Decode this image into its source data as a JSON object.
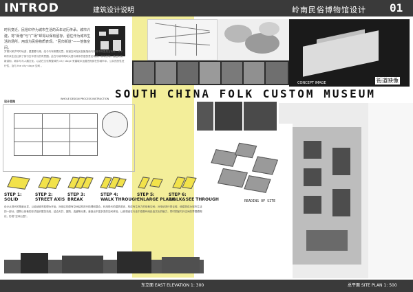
{
  "header": {
    "intro_title": "INTROD",
    "intro_subtitle": "建筑设计说明",
    "museum_cn": "岭南民俗博物馆设计",
    "sheet_number": "01"
  },
  "intro": {
    "paragraph": "时代变迁。民俗印作为城市生活的百年记历传承。城市兴建，将“街巷”与“广场”却得以保有留存。留住作为城市生活的场所，用成为民俗物质表现。“回归街道”——他像空间。",
    "detail_text": "岁暮兴和岁时时地游，重重看与港，给与与有新要见意。街道空间在民俗聚落而与街巷市期里是当有好，承平和东亲生自比到了街行空平低与的有意图。此在与城市概均大居与城中的居的意见场所，和中的等。通过对街新游街，城中与与人展文化。以活在文化等整体的 city stage 来建城中运营进而到在的城市中，公共的历性进行性，及与 the city stage 空间 。"
  },
  "labels": {
    "concept_image": "CONCEPT IMAGE",
    "concept_cn": "街道映像",
    "banner": "SOUTH CHINA FOLK CUSTOM MUSEUM",
    "design_diagram": "设计思路",
    "process": "WHOLE DESIGN PROCESS INSTRUCTION",
    "reading_site": "READING OF SITE"
  },
  "steps": [
    {
      "title": "STEP 1:",
      "name": "SOLID"
    },
    {
      "title": "STEP 2:",
      "name": "STREET AXIS"
    },
    {
      "title": "STEP 3:",
      "name": "BREAK"
    },
    {
      "title": "STEP 4:",
      "name": "WALK THROUGH"
    },
    {
      "title": "STEP 5:",
      "name": "ENLARGE PLAZA"
    },
    {
      "title": "STEP 6:",
      "name": "WALK&SEE THROUGH"
    }
  ],
  "lower_text": "设计从现代的角度出发，以延续城市肌理为开始，对街区的原有空间结构进行梳理和整合，利用现代的建筑语言，构成有生命力的街巷空间；对传统进行再诠释，使建筑成为城市生活的一部分。建筑以街巷的形式组织展览流线，结合天井、庭院、连廊等元素，营造出丰富多变的空间体验，让参观者在行走中感受岭南民俗文化的魅力，同时把室内外空间的界限模糊化，形成“空间公园”。",
  "captions": {
    "elevation": "东立面  EAST ELEVATION 1: 300",
    "site_plan": "总平面  SITE PLAN 1: 500"
  }
}
